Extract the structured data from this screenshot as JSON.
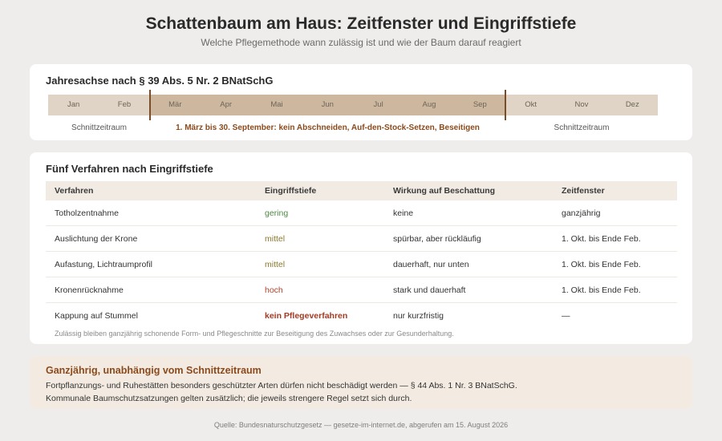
{
  "header": {
    "title": "Schattenbaum am Haus: Zeitfenster und Eingriffstiefe",
    "subtitle": "Welche Pflegemethode wann zulässig ist und wie der Baum darauf reagiert"
  },
  "timeline": {
    "title": "Jahresachse nach § 39 Abs. 5 Nr. 2 BNatSchG",
    "months": [
      {
        "label": "Jan",
        "restricted": false
      },
      {
        "label": "Feb",
        "restricted": false
      },
      {
        "label": "Mär",
        "restricted": true
      },
      {
        "label": "Apr",
        "restricted": true
      },
      {
        "label": "Mai",
        "restricted": true
      },
      {
        "label": "Jun",
        "restricted": true
      },
      {
        "label": "Jul",
        "restricted": true
      },
      {
        "label": "Aug",
        "restricted": true
      },
      {
        "label": "Sep",
        "restricted": true
      },
      {
        "label": "Okt",
        "restricted": false
      },
      {
        "label": "Nov",
        "restricted": false
      },
      {
        "label": "Dez",
        "restricted": false
      }
    ],
    "left_label": "Schnittzeitraum",
    "middle_label": "1. März bis 30. September: kein Abschneiden, Auf-den-Stock-Setzen, Beseitigen",
    "right_label": "Schnittzeitraum"
  },
  "table": {
    "title": "Fünf Verfahren nach Eingriffstiefe",
    "headers": [
      "Verfahren",
      "Eingriffstiefe",
      "Wirkung auf Beschattung",
      "Zeitfenster"
    ],
    "rows": [
      {
        "method": "Totholzentnahme",
        "depth": "gering",
        "level": "gering",
        "effect": "keine",
        "window": "ganzjährig"
      },
      {
        "method": "Auslichtung der Krone",
        "depth": "mittel",
        "level": "mittel",
        "effect": "spürbar, aber rückläufig",
        "window": "1. Okt. bis Ende Feb."
      },
      {
        "method": "Aufastung, Lichtraumprofil",
        "depth": "mittel",
        "level": "mittel",
        "effect": "dauerhaft, nur unten",
        "window": "1. Okt. bis Ende Feb."
      },
      {
        "method": "Kronenrücknahme",
        "depth": "hoch",
        "level": "hoch",
        "effect": "stark und dauerhaft",
        "window": "1. Okt. bis Ende Feb."
      },
      {
        "method": "Kappung auf Stummel",
        "depth": "kein Pflegeverfahren",
        "level": "kein",
        "effect": "nur kurzfristig",
        "window": "—"
      }
    ],
    "footnote": "Zulässig bleiben ganzjährig schonende Form- und Pflegeschnitte zur Beseitigung des Zuwachses oder zur Gesunderhaltung.",
    "level_colors": {
      "gering": "#4e8a46",
      "mittel": "#8a7a2a",
      "hoch": "#b0432c",
      "kein": "#a33a22"
    }
  },
  "note": {
    "title": "Ganzjährig, unabhängig vom Schnittzeitraum",
    "line1": "Fortpflanzungs- und Ruhestätten besonders geschützter Arten dürfen nicht beschädigt werden — § 44 Abs. 1 Nr. 3 BNatSchG.",
    "line2": "Kommunale Baumschutzsatzungen gelten zusätzlich; die jeweils strengere Regel setzt sich durch."
  },
  "source": "Quelle: Bundesnaturschutzgesetz — gesetze-im-internet.de, abgerufen am 15. August 2026",
  "colors": {
    "background": "#efedeb",
    "accent": "#8b4a1c",
    "month_restricted": "#cdb89f",
    "month_allowed": "#dfd4c5"
  }
}
